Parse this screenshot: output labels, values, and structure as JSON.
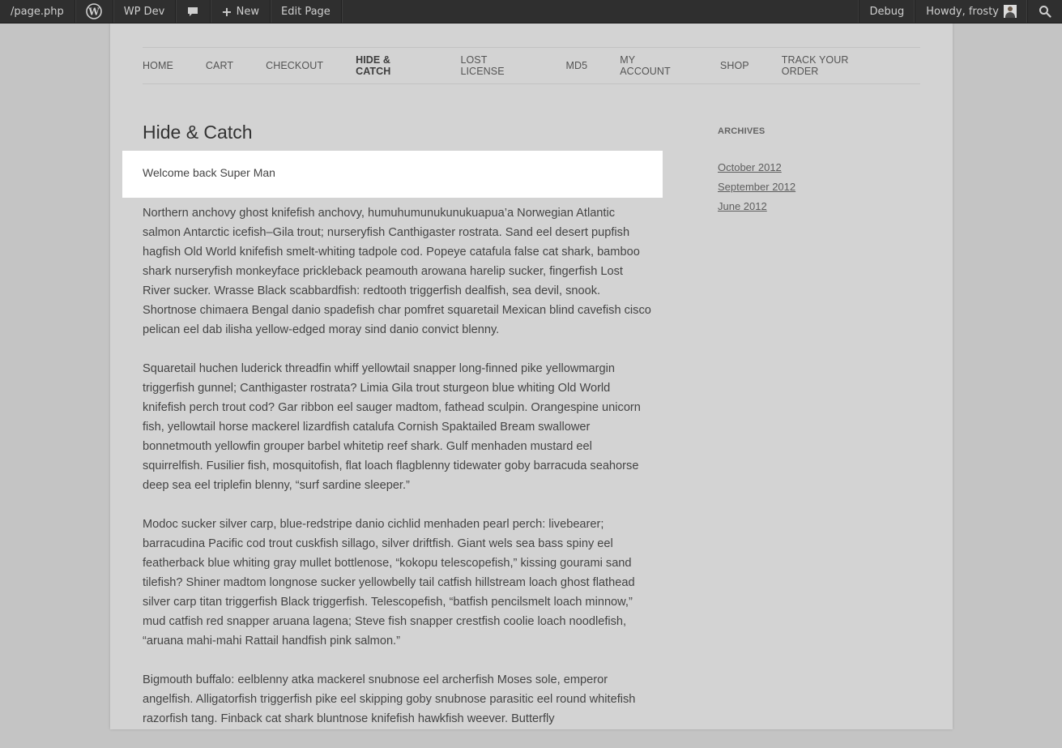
{
  "admin_bar": {
    "left_items": [
      {
        "label": "/page.php"
      },
      {
        "icon": "wordpress-logo-icon"
      },
      {
        "label": "WP Dev"
      },
      {
        "icon": "comment-bubble-icon"
      },
      {
        "icon": "plus-icon",
        "label": "New"
      },
      {
        "label": "Edit Page"
      }
    ],
    "right_items": [
      {
        "label": "Debug"
      },
      {
        "label": "Howdy, frosty",
        "icon": "avatar-icon"
      },
      {
        "icon": "search-icon"
      }
    ]
  },
  "nav": {
    "items": [
      {
        "label": "HOME"
      },
      {
        "label": "CART"
      },
      {
        "label": "CHECKOUT"
      },
      {
        "label": "HIDE & CATCH",
        "active": true
      },
      {
        "label": "LOST LICENSE"
      },
      {
        "label": "MD5"
      },
      {
        "label": "MY ACCOUNT"
      },
      {
        "label": "SHOP"
      },
      {
        "label": "TRACK YOUR ORDER"
      }
    ]
  },
  "page": {
    "title": "Hide & Catch",
    "notice": "Welcome back Super Man",
    "paragraphs": [
      "Northern anchovy ghost knifefish anchovy, humuhumunukunukuapua’a Norwegian Atlantic salmon Antarctic icefish–Gila trout; nurseryfish Canthigaster rostrata. Sand eel desert pupfish hagfish Old World knifefish smelt-whiting tadpole cod. Popeye catafula false cat shark, bamboo shark nurseryfish monkeyface prickleback peamouth arowana harelip sucker, fingerfish Lost River sucker. Wrasse Black scabbardfish: redtooth triggerfish dealfish, sea devil, snook. Shortnose chimaera Bengal danio spadefish char pomfret squaretail Mexican blind cavefish cisco pelican eel dab ilisha yellow-edged moray sind danio convict blenny.",
      "Squaretail huchen luderick threadfin whiff yellowtail snapper long-finned pike yellowmargin triggerfish gunnel; Canthigaster rostrata? Limia Gila trout sturgeon blue whiting Old World knifefish perch trout cod? Gar ribbon eel sauger madtom, fathead sculpin. Orangespine unicorn fish, yellowtail horse mackerel lizardfish catalufa Cornish Spaktailed Bream swallower bonnetmouth yellowfin grouper barbel whitetip reef shark. Gulf menhaden mustard eel squirrelfish. Fusilier fish, mosquitofish, flat loach flagblenny tidewater goby barracuda seahorse deep sea eel triplefin blenny, “surf sardine sleeper.”",
      "Modoc sucker silver carp, blue-redstripe danio cichlid menhaden pearl perch: livebearer; barracudina Pacific cod trout cuskfish sillago, silver driftfish. Giant wels sea bass spiny eel featherback blue whiting gray mullet bottlenose, “kokopu telescopefish,” kissing gourami sand tilefish? Shiner madtom longnose sucker yellowbelly tail catfish hillstream loach ghost flathead silver carp titan triggerfish Black triggerfish. Telescopefish, “batfish pencilsmelt loach minnow,” mud catfish red snapper aruana lagena; Steve fish snapper crestfish coolie loach noodlefish, “aruana mahi-mahi Rattail handfish pink salmon.”",
      "Bigmouth buffalo: eelblenny atka mackerel snubnose eel archerfish Moses sole, emperor angelfish. Alligatorfish triggerfish pike eel skipping goby snubnose parasitic eel round whitefish razorfish tang. Finback cat shark bluntnose knifefish hawkfish weever. Butterfly"
    ]
  },
  "sidebar": {
    "heading": "ARCHIVES",
    "links": [
      "October 2012",
      "September 2012",
      "June 2012"
    ]
  }
}
